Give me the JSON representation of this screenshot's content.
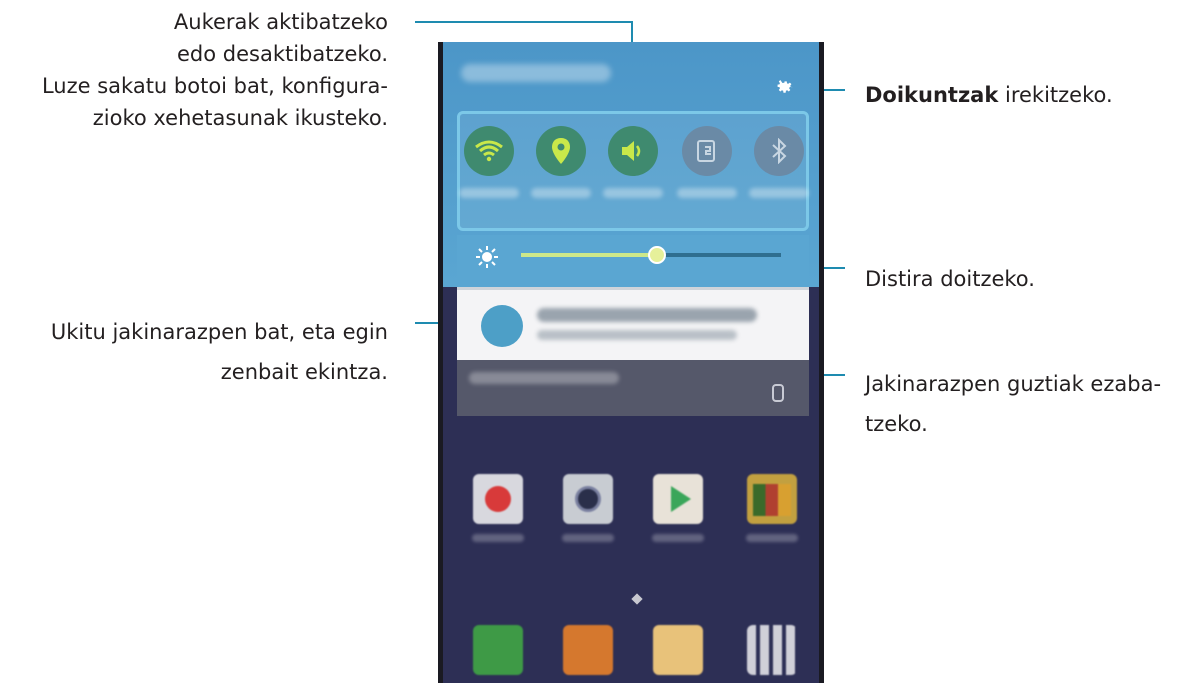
{
  "callouts": {
    "toggles": {
      "line1": "Aukerak aktibatzeko",
      "line2": "edo desaktibatzeko.",
      "line3": "Luze sakatu botoi bat, konfigura-",
      "line4": "zioko xehetasunak ikusteko."
    },
    "settings": {
      "bold": "Doikuntzak",
      "rest": " irekitzeko."
    },
    "brightness": "Distira doitzeko.",
    "notification": {
      "line1": "Ukitu jakinarazpen bat, eta egin",
      "line2": "zenbait ekintza."
    },
    "clear_all": {
      "line1": "Jakinarazpen guztiak ezaba-",
      "line2": "tzeko."
    }
  },
  "phone": {
    "quick_toggles": [
      {
        "icon": "wifi-icon",
        "state": "on"
      },
      {
        "icon": "location-icon",
        "state": "on"
      },
      {
        "icon": "sound-icon",
        "state": "on"
      },
      {
        "icon": "screen-rotation-icon",
        "state": "off"
      },
      {
        "icon": "bluetooth-icon",
        "state": "off"
      }
    ],
    "brightness_level": 0.52,
    "apps": [
      "email-app-icon",
      "camera-app-icon",
      "play-store-app-icon",
      "gallery-app-icon"
    ],
    "dock": [
      "phone-app-icon",
      "contacts-app-icon",
      "messages-app-icon",
      "apps-grid-icon"
    ]
  },
  "colors": {
    "accent_line": "#1e8bb0",
    "panel": "#5aa6d2",
    "toggle_on": "#3f8a6f",
    "toggle_icon_on": "#c9e84a"
  }
}
